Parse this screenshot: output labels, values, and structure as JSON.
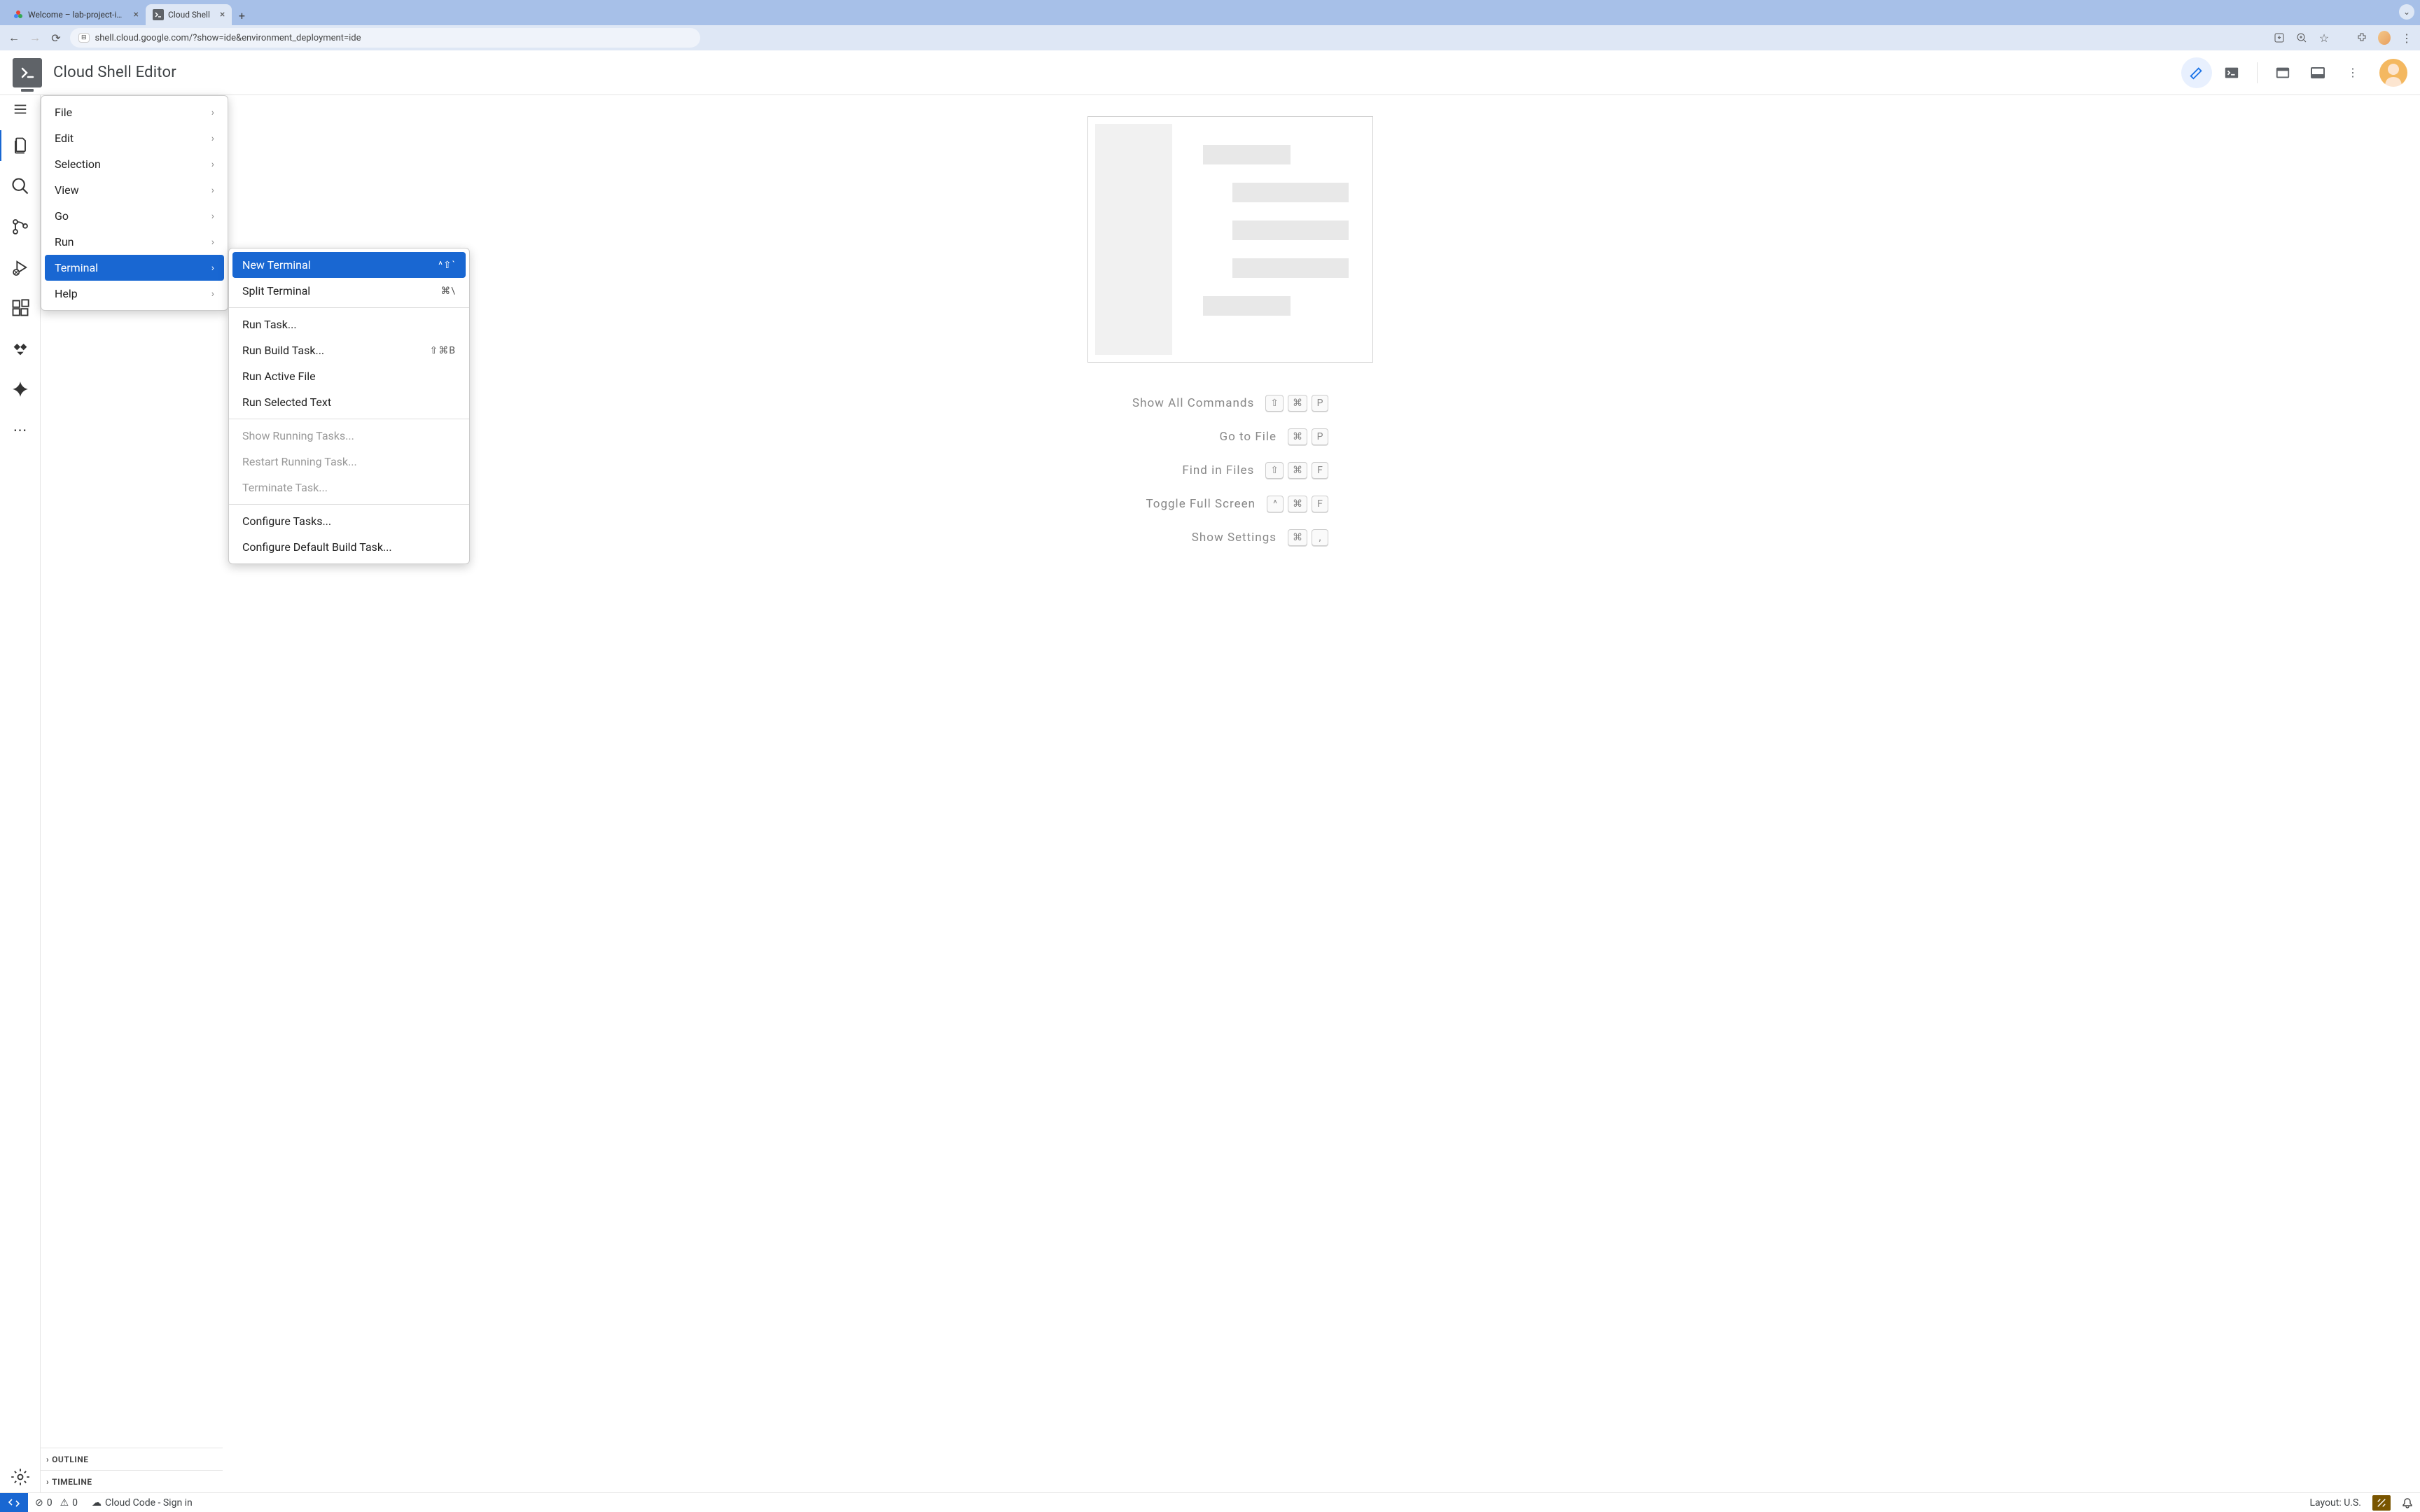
{
  "browser": {
    "tabs": [
      {
        "title": "Welcome – lab-project-id-e…",
        "active": false
      },
      {
        "title": "Cloud Shell",
        "active": true
      }
    ],
    "url": "shell.cloud.google.com/?show=ide&environment_deployment=ide"
  },
  "app": {
    "title": "Cloud Shell Editor"
  },
  "main_menu": [
    {
      "label": "File",
      "submenu": true
    },
    {
      "label": "Edit",
      "submenu": true
    },
    {
      "label": "Selection",
      "submenu": true
    },
    {
      "label": "View",
      "submenu": true
    },
    {
      "label": "Go",
      "submenu": true
    },
    {
      "label": "Run",
      "submenu": true
    },
    {
      "label": "Terminal",
      "submenu": true,
      "highlighted": true
    },
    {
      "label": "Help",
      "submenu": true
    }
  ],
  "terminal_submenu": [
    {
      "label": "New Terminal",
      "shortcut": "^⇧`",
      "highlighted": true
    },
    {
      "label": "Split Terminal",
      "shortcut": "⌘\\"
    },
    {
      "sep": true
    },
    {
      "label": "Run Task..."
    },
    {
      "label": "Run Build Task...",
      "shortcut": "⇧⌘B"
    },
    {
      "label": "Run Active File"
    },
    {
      "label": "Run Selected Text"
    },
    {
      "sep": true
    },
    {
      "label": "Show Running Tasks...",
      "disabled": true
    },
    {
      "label": "Restart Running Task...",
      "disabled": true
    },
    {
      "label": "Terminate Task...",
      "disabled": true
    },
    {
      "sep": true
    },
    {
      "label": "Configure Tasks..."
    },
    {
      "label": "Configure Default Build Task..."
    }
  ],
  "shortcuts": [
    {
      "label": "Show All Commands",
      "keys": [
        "⇧",
        "⌘",
        "P"
      ]
    },
    {
      "label": "Go to File",
      "keys": [
        "⌘",
        "P"
      ]
    },
    {
      "label": "Find in Files",
      "keys": [
        "⇧",
        "⌘",
        "F"
      ]
    },
    {
      "label": "Toggle Full Screen",
      "keys": [
        "^",
        "⌘",
        "F"
      ]
    },
    {
      "label": "Show Settings",
      "keys": [
        "⌘",
        ","
      ]
    }
  ],
  "sidebar_panels": {
    "outline": "OUTLINE",
    "timeline": "TIMELINE"
  },
  "status": {
    "errors": "0",
    "warnings": "0",
    "cloud_code": "Cloud Code - Sign in",
    "layout": "Layout: U.S."
  }
}
